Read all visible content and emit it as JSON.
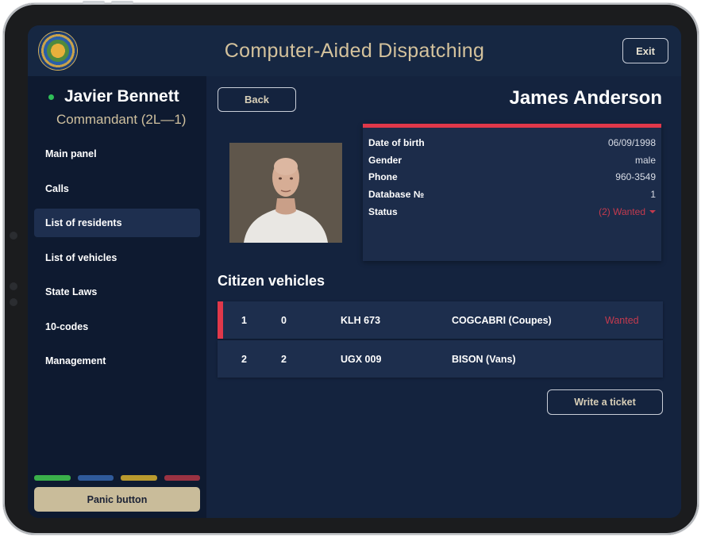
{
  "header": {
    "title": "Computer-Aided Dispatching",
    "exit_label": "Exit",
    "seal_icon": "state-seal-icon"
  },
  "sidebar": {
    "user": {
      "name": "Javier Bennett",
      "rank": "Commandant (2L—1)",
      "status_color": "#2fbf58"
    },
    "items": [
      {
        "label": "Main panel",
        "active": false
      },
      {
        "label": "Calls",
        "active": false
      },
      {
        "label": "List of residents",
        "active": true
      },
      {
        "label": "List of vehicles",
        "active": false
      },
      {
        "label": "State Laws",
        "active": false
      },
      {
        "label": "10-codes",
        "active": false
      },
      {
        "label": "Management",
        "active": false
      }
    ],
    "status_colors": [
      "#3ab04a",
      "#2f5a9a",
      "#b99a2e",
      "#9a3242"
    ],
    "panic_label": "Panic button"
  },
  "main": {
    "back_label": "Back",
    "person_name": "James Anderson",
    "info": [
      {
        "label": "Date of birth",
        "value": "06/09/1998"
      },
      {
        "label": "Gender",
        "value": "male"
      },
      {
        "label": "Phone",
        "value": "960-3549"
      },
      {
        "label": "Database №",
        "value": "1"
      },
      {
        "label": "Status",
        "value": "(2) Wanted"
      }
    ],
    "accent_color": "#e0384a",
    "vehicles_title": "Citizen vehicles",
    "vehicles": [
      {
        "id": "1",
        "count": "0",
        "plate": "KLH 673",
        "model": "COGCABRI (Coupes)",
        "status": "Wanted"
      },
      {
        "id": "2",
        "count": "2",
        "plate": "UGX 009",
        "model": "BISON (Vans)",
        "status": ""
      }
    ],
    "ticket_label": "Write a ticket"
  }
}
